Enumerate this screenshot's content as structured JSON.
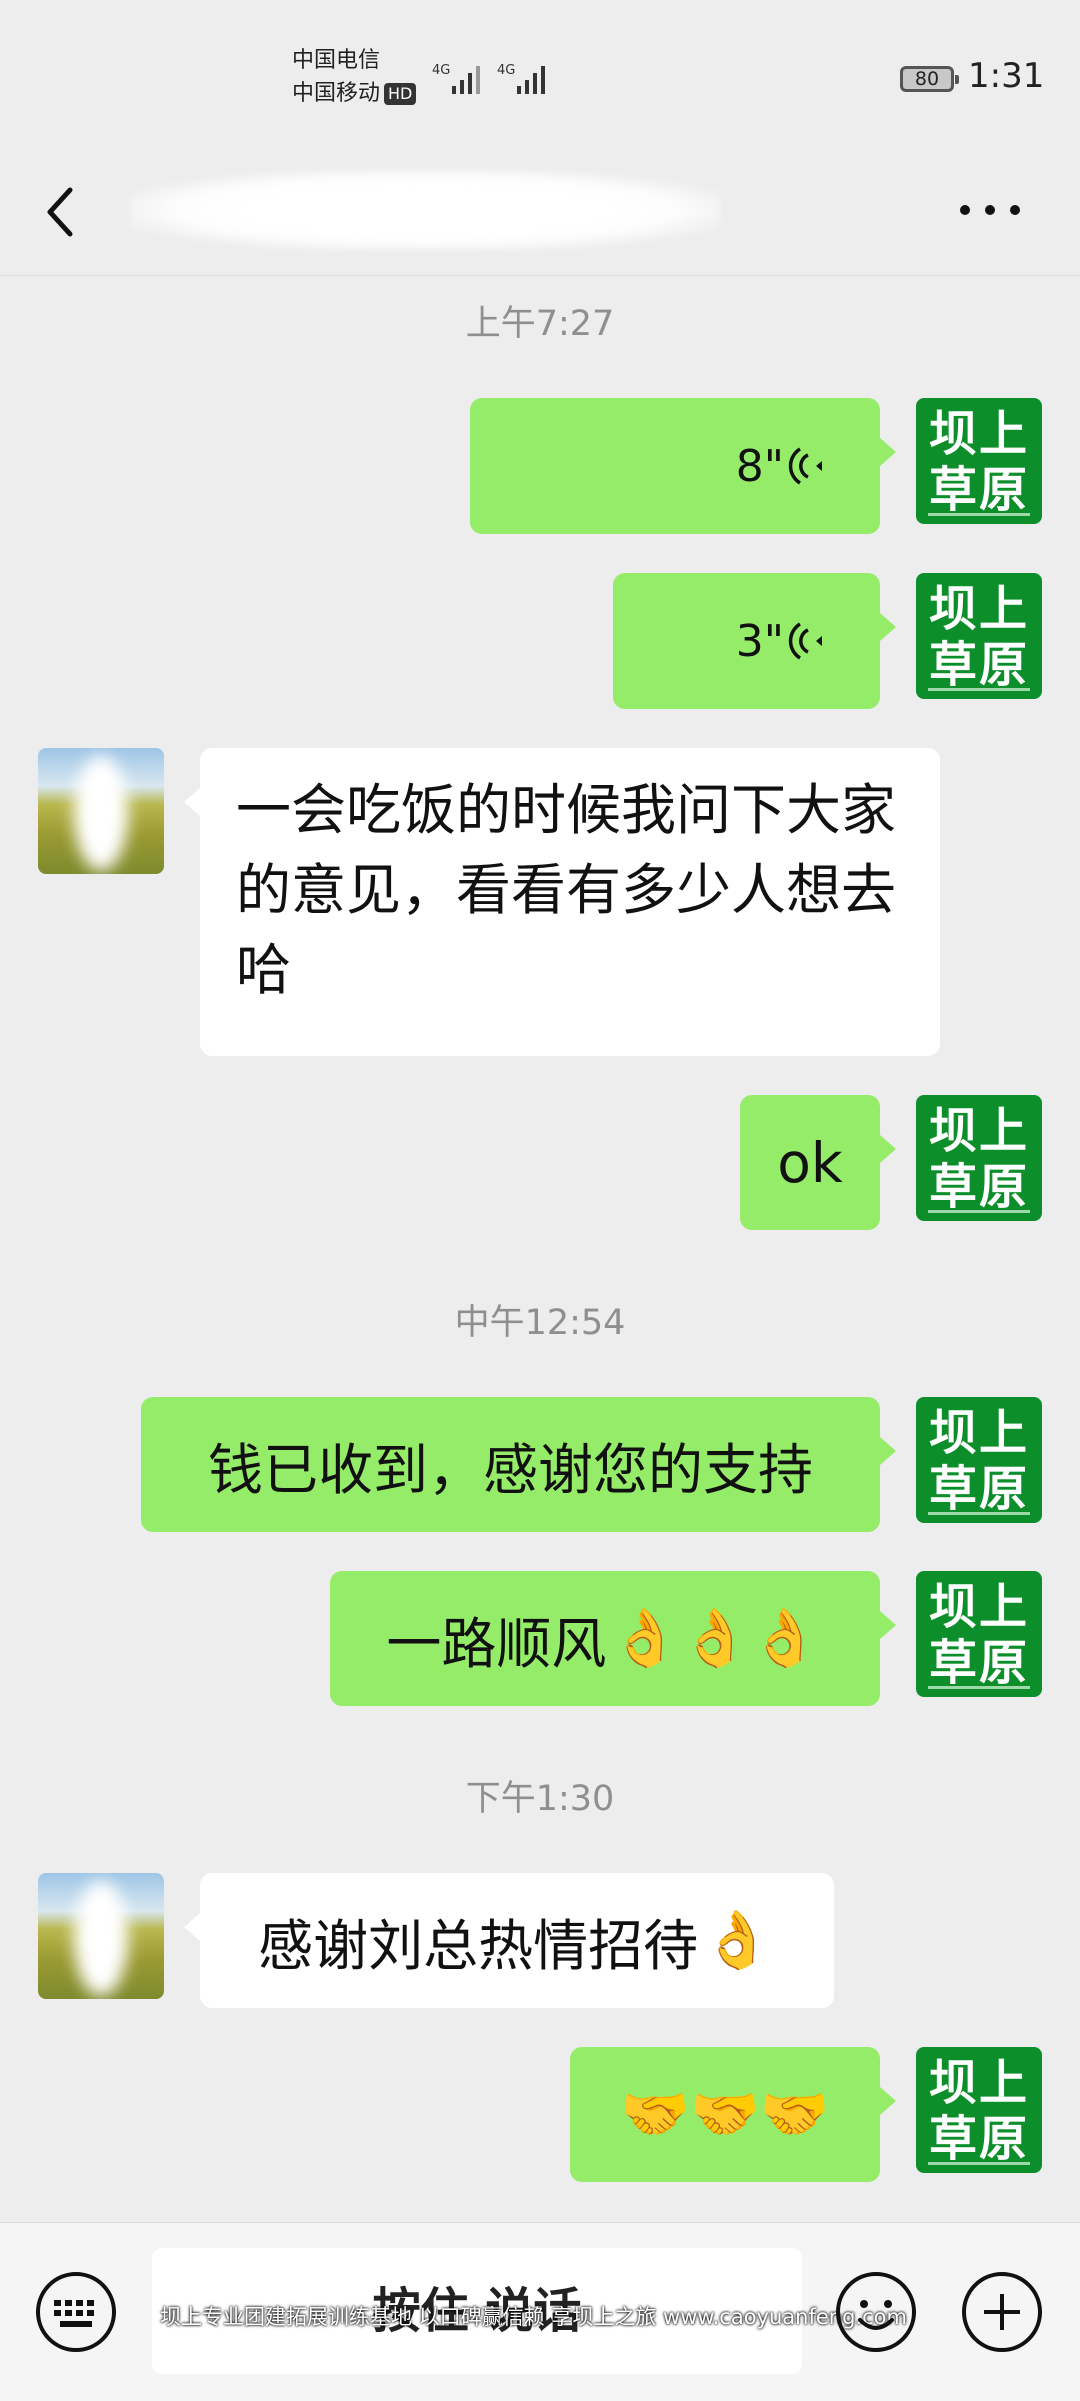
{
  "status_bar": {
    "carrier_1": "中国电信",
    "carrier_2": "中国移动",
    "hd_badge": "HD",
    "network_1": "4G",
    "network_2": "4G",
    "battery": "80",
    "time": "1:31"
  },
  "header": {
    "title": "",
    "back_icon": "chevron-left-icon",
    "more_icon": "more-horizontal-icon"
  },
  "messages": {
    "ts_1": "上午7:27",
    "voice_1_duration": "8\"",
    "voice_2_duration": "3\"",
    "other_1_text": "一会吃饭的时候我问下大家的意见，看看有多少人想去哈",
    "me_ok": "ok",
    "ts_2": "中午12:54",
    "me_received": "钱已收到，感谢您的支持",
    "me_bon_voyage": "一路顺风",
    "me_bon_voyage_emoji": "👌👌👌",
    "ts_3": "下午1:30",
    "other_2_text": "感谢刘总热情招待",
    "other_2_emoji": "👌",
    "me_handshakes": "🤝🤝🤝"
  },
  "my_avatar": {
    "line_1": "坝上",
    "line_2": "草原"
  },
  "input_bar": {
    "hold_to_talk": "按住 说话",
    "watermark": "坝上专业团建拓展训练基地 以口碑赢信赖 享坝上之旅 www.caoyuanfeng.com"
  },
  "colors": {
    "background": "#ededed",
    "my_bubble": "#95ec69",
    "other_bubble": "#ffffff",
    "my_avatar_bg": "#0c8f2a"
  }
}
